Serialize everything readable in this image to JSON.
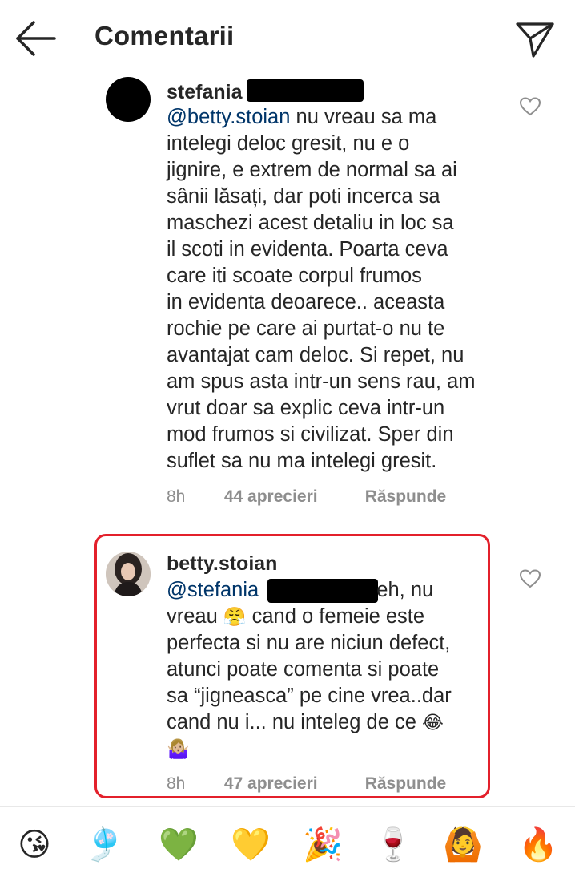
{
  "header": {
    "title": "Comentarii",
    "back_icon": "arrow-left-icon",
    "send_icon": "paper-plane-icon"
  },
  "comments": [
    {
      "username": "stefania",
      "lines": [
        {
          "mention": "@betty.stoian",
          "text": " nu vreau sa ma"
        },
        {
          "text": "intelegi deloc gresit, nu e o"
        },
        {
          "text": "jignire, e extrem de normal sa ai"
        },
        {
          "text": "sânii lăsați, dar poti incerca sa"
        },
        {
          "text": "maschezi acest detaliu in loc sa"
        },
        {
          "text": "il scoti in evidenta. Poarta ceva"
        },
        {
          "text": "care iti scoate corpul frumos"
        },
        {
          "text": "in evidenta deoarece.. aceasta"
        },
        {
          "text": "rochie pe care ai purtat-o nu te"
        },
        {
          "text": "avantajat cam deloc. Si repet, nu"
        },
        {
          "text": "am spus asta intr-un sens rau, am"
        },
        {
          "text": "vrut doar sa explic ceva intr-un"
        },
        {
          "text": "mod frumos si civilizat. Sper din"
        },
        {
          "text": "suflet sa nu ma intelegi gresit."
        }
      ],
      "time": "8h",
      "likes": "44 aprecieri",
      "reply": "Răspunde"
    },
    {
      "username": "betty.stoian",
      "line1_mention": "@stefania",
      "line1_text": " eh, nu",
      "line2_a": "vreau ",
      "line2_emoji": "😤",
      "line2_b": " cand o femeie este",
      "line3": "perfecta si nu are niciun defect,",
      "line4": "atunci poate comenta si poate",
      "line5": "sa “jigneasca” pe cine vrea..dar",
      "line6_a": "cand nu i... nu inteleg de ce ",
      "line6_emoji": "😂",
      "line7_emoji": "🤷🏼‍♀️",
      "time": "8h",
      "likes": "47 aprecieri",
      "reply": "Răspunde"
    }
  ],
  "emoji_bar": [
    "😘",
    "🎐",
    "💚",
    "💛",
    "🎉",
    "🍷",
    "🙆",
    "🔥"
  ]
}
